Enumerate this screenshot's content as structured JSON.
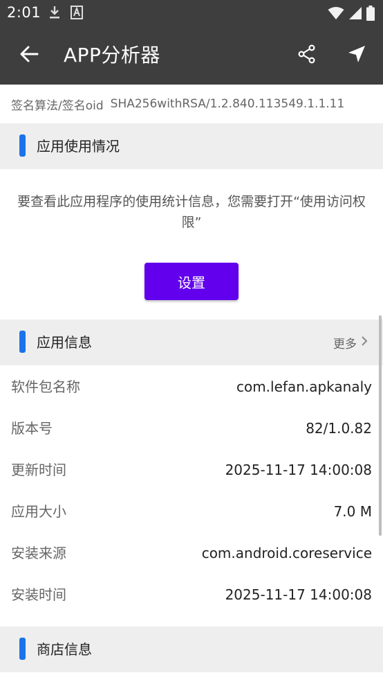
{
  "status_bar": {
    "time": "2:01",
    "icons_left": [
      "download-icon",
      "font-icon"
    ],
    "icons_right": [
      "wifi-icon",
      "signal-icon",
      "battery-icon"
    ]
  },
  "app_bar": {
    "title": "APP分析器",
    "background": "#3e3e3e",
    "icons": [
      "back-arrow-icon",
      "share-icon",
      "send-icon"
    ]
  },
  "signature": {
    "label": "签名算法/签名oid",
    "value": "SHA256withRSA/1.2.840.113549.1.1.11"
  },
  "usage_section": {
    "title": "应用使用情况",
    "message": "要查看此应用程序的使用统计信息，您需要打开“使用访问权限”",
    "button_label": "设置",
    "button_color": "#6200ee"
  },
  "app_info_section": {
    "title": "应用信息",
    "more_label": "更多",
    "accent_color": "#1a73e8",
    "rows": [
      {
        "label": "软件包名称",
        "value": "com.lefan.apkanaly"
      },
      {
        "label": "版本号",
        "value": "82/1.0.82"
      },
      {
        "label": "更新时间",
        "value": "2025-11-17 14:00:08"
      },
      {
        "label": "应用大小",
        "value": "7.0 M"
      },
      {
        "label": "安装来源",
        "value": "com.android.coreservice"
      },
      {
        "label": "安装时间",
        "value": "2025-11-17 14:00:08"
      }
    ]
  },
  "store_section": {
    "title": "商店信息"
  }
}
